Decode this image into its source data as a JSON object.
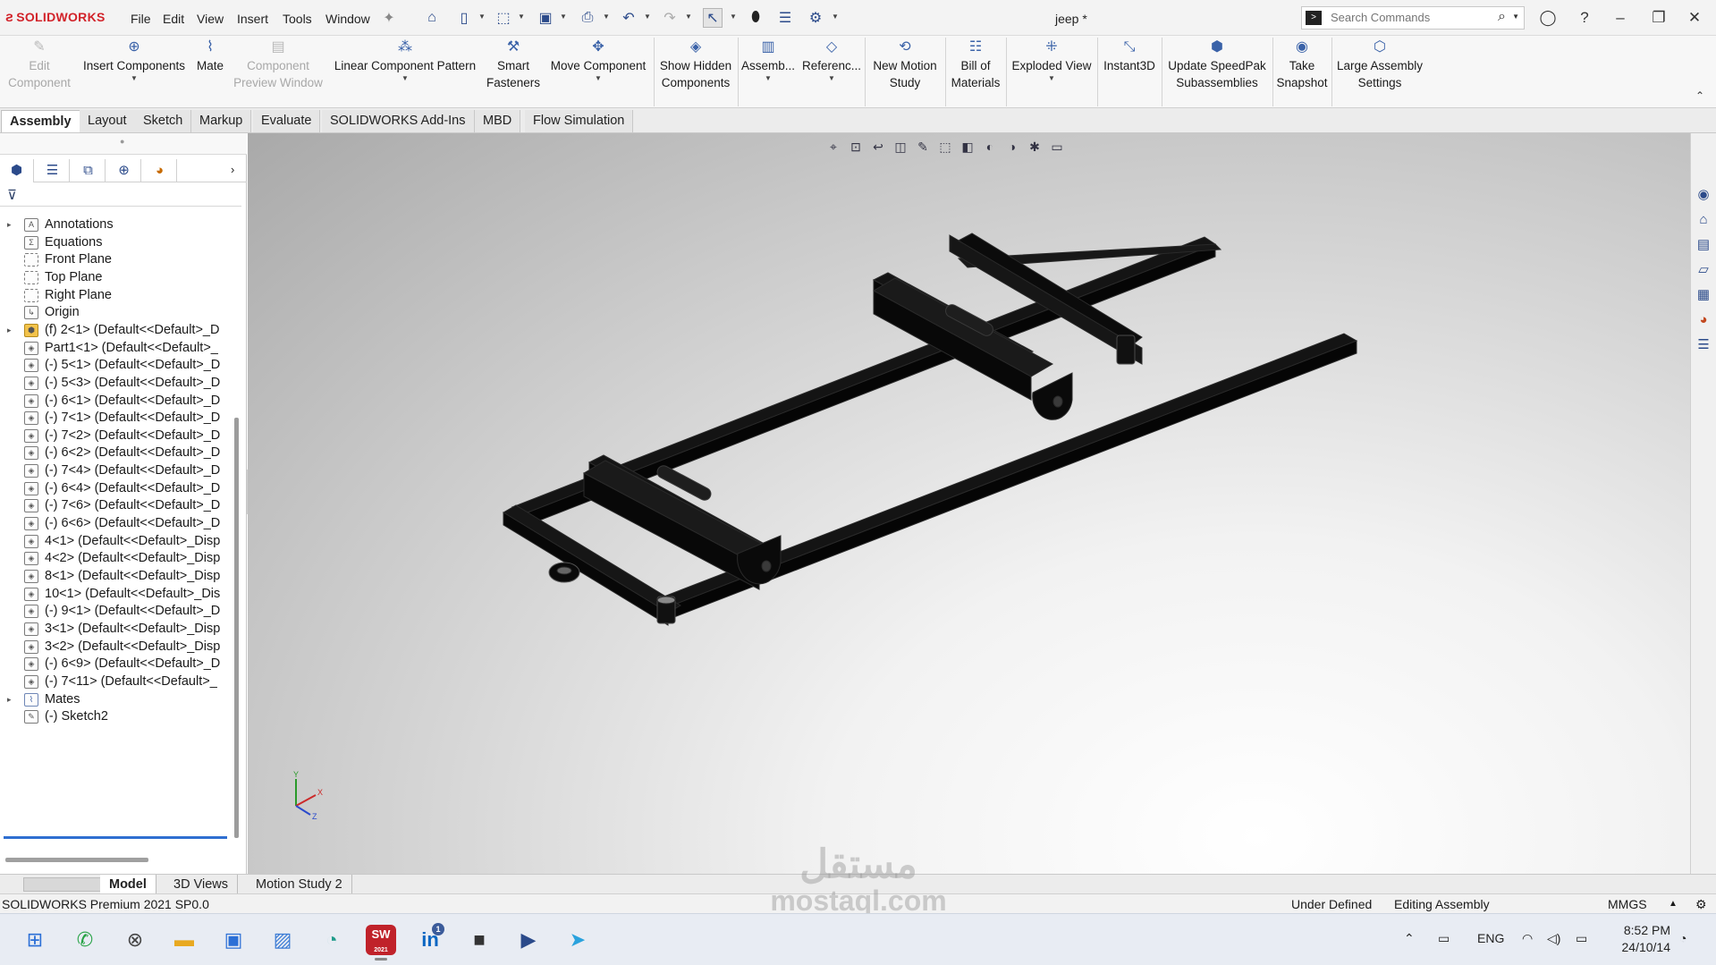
{
  "app": {
    "logo_text": "SOLIDWORKS",
    "document_title": "jeep *",
    "menu": [
      "File",
      "Edit",
      "View",
      "Insert",
      "Tools",
      "Window"
    ],
    "search_placeholder": "Search Commands"
  },
  "ribbon": [
    {
      "label1": "Edit",
      "label2": "Component",
      "icon": "edit-component-icon",
      "enabled": false
    },
    {
      "label1": "Insert Components",
      "label2": "",
      "icon": "insert-components-icon",
      "enabled": true,
      "caret": true
    },
    {
      "label1": "Mate",
      "label2": "",
      "icon": "mate-icon",
      "enabled": true
    },
    {
      "label1": "Component",
      "label2": "Preview Window",
      "icon": "component-preview-icon",
      "enabled": false
    },
    {
      "label1": "Linear Component Pattern",
      "label2": "",
      "icon": "linear-pattern-icon",
      "enabled": true,
      "caret": true
    },
    {
      "label1": "Smart",
      "label2": "Fasteners",
      "icon": "smart-fasteners-icon",
      "enabled": true
    },
    {
      "label1": "Move Component",
      "label2": "",
      "icon": "move-component-icon",
      "enabled": true,
      "caret": true
    },
    {
      "label1": "Show Hidden",
      "label2": "Components",
      "icon": "show-hidden-icon",
      "enabled": true
    },
    {
      "label1": "Assemb...",
      "label2": "",
      "icon": "assembly-features-icon",
      "enabled": true,
      "caret": true
    },
    {
      "label1": "Referenc...",
      "label2": "",
      "icon": "reference-geometry-icon",
      "enabled": true,
      "caret": true
    },
    {
      "label1": "New Motion",
      "label2": "Study",
      "icon": "motion-study-icon",
      "enabled": true
    },
    {
      "label1": "Bill of",
      "label2": "Materials",
      "icon": "bill-of-materials-icon",
      "enabled": true
    },
    {
      "label1": "Exploded View",
      "label2": "",
      "icon": "exploded-view-icon",
      "enabled": true,
      "caret": true
    },
    {
      "label1": "Instant3D",
      "label2": "",
      "icon": "instant3d-icon",
      "enabled": true
    },
    {
      "label1": "Update SpeedPak",
      "label2": "Subassemblies",
      "icon": "speedpak-icon",
      "enabled": true
    },
    {
      "label1": "Take",
      "label2": "Snapshot",
      "icon": "snapshot-icon",
      "enabled": true
    },
    {
      "label1": "Large Assembly",
      "label2": "Settings",
      "icon": "large-assembly-icon",
      "enabled": true
    }
  ],
  "command_tabs": [
    "Assembly",
    "Layout",
    "Sketch",
    "Markup",
    "Evaluate",
    "SOLIDWORKS Add-Ins",
    "MBD",
    "Flow Simulation"
  ],
  "tree": [
    {
      "label": "Annotations",
      "expandable": true,
      "icon": "annotations-icon"
    },
    {
      "label": "Equations",
      "expandable": false,
      "icon": "equations-icon"
    },
    {
      "label": "Front Plane",
      "expandable": false,
      "icon": "plane-icon"
    },
    {
      "label": "Top Plane",
      "expandable": false,
      "icon": "plane-icon"
    },
    {
      "label": "Right Plane",
      "expandable": false,
      "icon": "plane-icon"
    },
    {
      "label": "Origin",
      "expandable": false,
      "icon": "origin-icon"
    },
    {
      "label": "(f) 2<1> (Default<<Default>_D",
      "expandable": true,
      "icon": "subassembly-icon"
    },
    {
      "label": "Part1<1> (Default<<Default>_",
      "expandable": false,
      "icon": "part-icon"
    },
    {
      "label": "(-) 5<1> (Default<<Default>_D",
      "expandable": false,
      "icon": "part-icon"
    },
    {
      "label": "(-) 5<3> (Default<<Default>_D",
      "expandable": false,
      "icon": "part-icon"
    },
    {
      "label": "(-) 6<1> (Default<<Default>_D",
      "expandable": false,
      "icon": "part-icon"
    },
    {
      "label": "(-) 7<1> (Default<<Default>_D",
      "expandable": false,
      "icon": "part-icon"
    },
    {
      "label": "(-) 7<2> (Default<<Default>_D",
      "expandable": false,
      "icon": "part-icon"
    },
    {
      "label": "(-) 6<2> (Default<<Default>_D",
      "expandable": false,
      "icon": "part-icon"
    },
    {
      "label": "(-) 7<4> (Default<<Default>_D",
      "expandable": false,
      "icon": "part-icon"
    },
    {
      "label": "(-) 6<4> (Default<<Default>_D",
      "expandable": false,
      "icon": "part-icon"
    },
    {
      "label": "(-) 7<6> (Default<<Default>_D",
      "expandable": false,
      "icon": "part-icon"
    },
    {
      "label": "(-) 6<6> (Default<<Default>_D",
      "expandable": false,
      "icon": "part-icon"
    },
    {
      "label": "4<1> (Default<<Default>_Disp",
      "expandable": false,
      "icon": "part-icon"
    },
    {
      "label": "4<2> (Default<<Default>_Disp",
      "expandable": false,
      "icon": "part-icon"
    },
    {
      "label": "8<1> (Default<<Default>_Disp",
      "expandable": false,
      "icon": "part-icon"
    },
    {
      "label": "10<1> (Default<<Default>_Dis",
      "expandable": false,
      "icon": "part-icon"
    },
    {
      "label": "(-) 9<1> (Default<<Default>_D",
      "expandable": false,
      "icon": "part-icon"
    },
    {
      "label": "3<1> (Default<<Default>_Disp",
      "expandable": false,
      "icon": "part-icon"
    },
    {
      "label": "3<2> (Default<<Default>_Disp",
      "expandable": false,
      "icon": "part-icon"
    },
    {
      "label": "(-) 6<9> (Default<<Default>_D",
      "expandable": false,
      "icon": "part-icon"
    },
    {
      "label": "(-) 7<11> (Default<<Default>_",
      "expandable": false,
      "icon": "part-icon"
    },
    {
      "label": "Mates",
      "expandable": true,
      "icon": "mates-icon"
    },
    {
      "label": "(-) Sketch2",
      "expandable": false,
      "icon": "sketch-icon"
    }
  ],
  "bottom_tabs": [
    "Model",
    "3D Views",
    "Motion Study 2"
  ],
  "status": {
    "left": "SOLIDWORKS Premium 2021 SP0.0",
    "definition": "Under Defined",
    "mode": "Editing Assembly",
    "units": "MMGS"
  },
  "triad": {
    "x": "X",
    "y": "Y",
    "z": "Z"
  },
  "watermark": {
    "arabic": "مستقل",
    "latin": "mostaql.com"
  },
  "taskbar": {
    "apps": [
      "windows-start-icon",
      "whatsapp-icon",
      "xbox-icon",
      "file-explorer-icon",
      "store-icon",
      "photos-icon",
      "edge-icon",
      "solidworks-icon",
      "linkedin-icon",
      "terminal-icon",
      "media-player-icon",
      "telegram-icon"
    ],
    "solidworks_label": "SW",
    "solidworks_year": "2021",
    "linkedin_badge": "1",
    "language": "ENG",
    "time": "8:52 PM",
    "date": "24/10/14"
  },
  "colors": {
    "model": "#0b0b0b",
    "accent": "#2f6fd1",
    "logo": "#d2232a"
  }
}
